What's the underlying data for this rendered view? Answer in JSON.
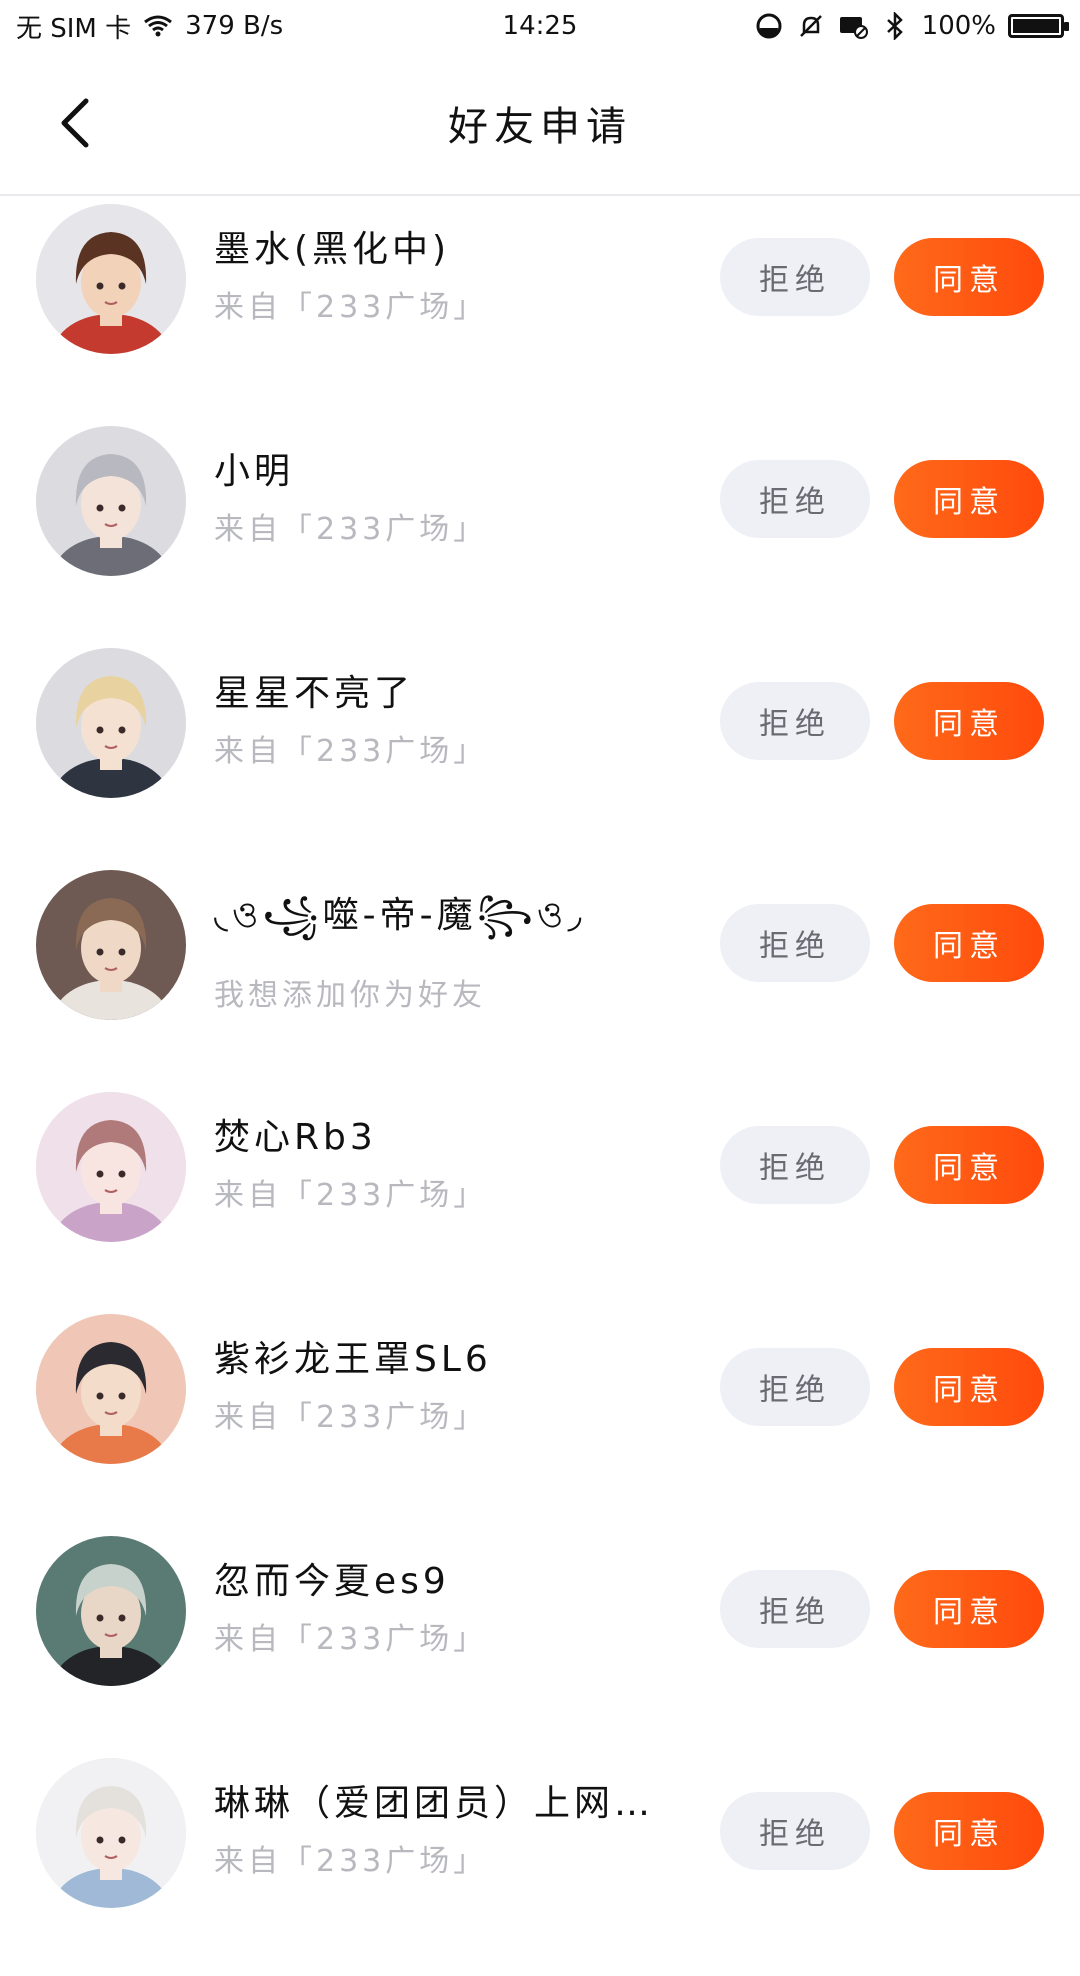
{
  "status_bar": {
    "carrier": "无 SIM 卡",
    "speed": "379 B/s",
    "time": "14:25",
    "battery": "100%",
    "battery_level": 1.0,
    "icons": [
      "wifi-icon",
      "data-saver-icon",
      "mute-icon",
      "message-blocked-icon",
      "bluetooth-icon",
      "battery-icon"
    ]
  },
  "header": {
    "title": "好友申请",
    "back_icon": "chevron-left-icon"
  },
  "colors": {
    "accent_start": "#ff6a1a",
    "accent_end": "#ff4a0c",
    "reject_bg": "#eef0f5",
    "subtext": "#b8b8bf"
  },
  "buttons": {
    "reject": "拒绝",
    "accept": "同意"
  },
  "requests": [
    {
      "name": "墨水(黑化中)",
      "source": "来自「233广场」",
      "avatar": "avatar-brown-hair"
    },
    {
      "name": "小明",
      "source": "来自「233广场」",
      "avatar": "avatar-silver-hair"
    },
    {
      "name": "星星不亮了",
      "source": "来自「233广场」",
      "avatar": "avatar-blonde-hair"
    },
    {
      "name": "◟ও꧁噬-帝-魔꧂ও◞",
      "source": "我想添加你为好友",
      "avatar": "avatar-boy-photo"
    },
    {
      "name": "焚心Rb3",
      "source": "来自「233广场」",
      "avatar": "avatar-pink-hair"
    },
    {
      "name": "紫衫龙王罩SL6",
      "source": "来自「233广场」",
      "avatar": "avatar-dark-hair"
    },
    {
      "name": "忽而今夏es9",
      "source": "来自「233广场」",
      "avatar": "avatar-masked-ninja"
    },
    {
      "name": "琳琳（爱团团员）上网…",
      "source": "来自「233广场」",
      "avatar": "avatar-white-hair"
    }
  ]
}
